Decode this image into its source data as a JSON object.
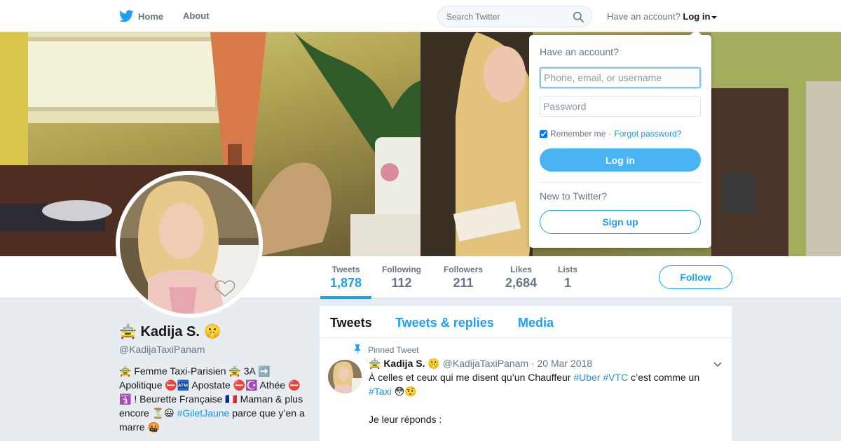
{
  "colors": {
    "accent": "#1da1f2",
    "link": "#1b95e0",
    "muted": "#657786"
  },
  "topnav": {
    "home_label": "Home",
    "about_label": "About",
    "search_placeholder": "Search Twitter",
    "have_account_label": "Have an account?",
    "login_label": "Log in"
  },
  "login_dropdown": {
    "title": "Have an account?",
    "username_placeholder": "Phone, email, or username",
    "password_placeholder": "Password",
    "remember_label": "Remember me",
    "separator": "·",
    "forgot_label": "Forgot password?",
    "login_button": "Log in",
    "new_label": "New to Twitter?",
    "signup_button": "Sign up"
  },
  "profile": {
    "name": "🚖 Kadija S. 🤫",
    "handle": "@KadijaTaxiPanam",
    "bio_before": "🚖 Femme Taxi-Parisien 🚖 3A ➡️ Apolitique ⛔🏧 Apostate ⛔☪️ Athée ⛔🛐 ! Beurette Française 🇫🇷 Maman & plus encore ⏳😃 ",
    "bio_hashtag": "#GiletJaune",
    "bio_after": " parce que y’en a marre 🤬"
  },
  "stats": [
    {
      "label": "Tweets",
      "value": "1,878"
    },
    {
      "label": "Following",
      "value": "112"
    },
    {
      "label": "Followers",
      "value": "211"
    },
    {
      "label": "Likes",
      "value": "2,684"
    },
    {
      "label": "Lists",
      "value": "1"
    }
  ],
  "follow_button": "Follow",
  "timeline": {
    "tabs": [
      "Tweets",
      "Tweets & replies",
      "Media"
    ],
    "pinned_label": "Pinned Tweet",
    "tweet": {
      "name": "🚖 Kadija S. 🤫",
      "handle": "@KadijaTaxiPanam",
      "dot": "·",
      "date": "20 Mar 2018",
      "text_1": "À celles et ceux qui me disent qu’un Chauffeur ",
      "hashtag_1": "#Uber",
      "hashtag_2": "#VTC",
      "text_2": " c’est comme un ",
      "hashtag_3": "#Taxi",
      "text_3": " 😳🤨",
      "text_4": "Je leur réponds :"
    }
  }
}
